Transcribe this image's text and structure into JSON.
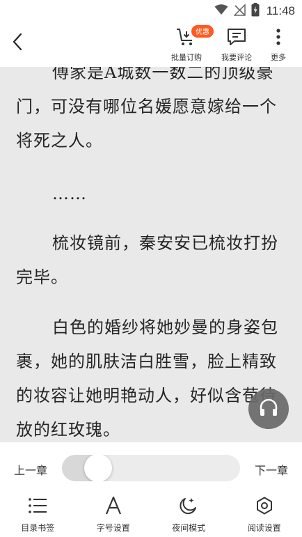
{
  "status_bar": {
    "time": "11:48"
  },
  "top_bar": {
    "badge": "优惠",
    "actions": [
      {
        "label": "批量订购",
        "icon": "cart-download-icon"
      },
      {
        "label": "我要评论",
        "icon": "comment-icon"
      },
      {
        "label": "更多",
        "icon": "more-vertical-icon"
      }
    ]
  },
  "content": {
    "paragraphs": [
      "傅家是A城数一数二的顶级豪门，可没有哪位名媛愿意嫁给一个将死之人。",
      "……",
      "梳妆镜前，秦安安已梳妆打扮完毕。",
      "白色的婚纱将她妙曼的身姿包裹，她的肌肤洁白胜雪，脸上精致的妆容让她明艳动人，好似含苞待放的红玫瑰。"
    ]
  },
  "chapter_nav": {
    "prev_label": "上一章",
    "next_label": "下一章",
    "progress": 0.05
  },
  "toolbar": {
    "items": [
      {
        "label": "目录书签",
        "icon": "list-icon"
      },
      {
        "label": "字号设置",
        "icon": "font-size-icon"
      },
      {
        "label": "夜间模式",
        "icon": "moon-icon"
      },
      {
        "label": "阅读设置",
        "icon": "settings-hexagon-icon"
      }
    ]
  },
  "colors": {
    "badge": "#ff5a1f",
    "reading_background": "#e9e9e9"
  }
}
